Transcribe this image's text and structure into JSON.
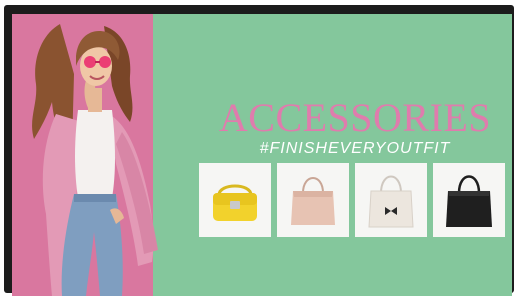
{
  "ad": {
    "headline": "ACCESSORIES",
    "hashtag": "#FINISHEVERYOUTFIT"
  },
  "products": [
    {
      "name": "yellow-handbag-icon",
      "color": "#f2d22c"
    },
    {
      "name": "blush-tote-icon",
      "color": "#e7c3b3"
    },
    {
      "name": "white-bow-tote-icon",
      "color": "#ece6de"
    },
    {
      "name": "black-tote-icon",
      "color": "#1f1f1f"
    }
  ],
  "colors": {
    "panel_green": "#84c79c",
    "panel_pink": "#d9779f",
    "headline": "#df7cad",
    "hashtag": "#ffffff",
    "bezel": "#1c1c1c"
  }
}
